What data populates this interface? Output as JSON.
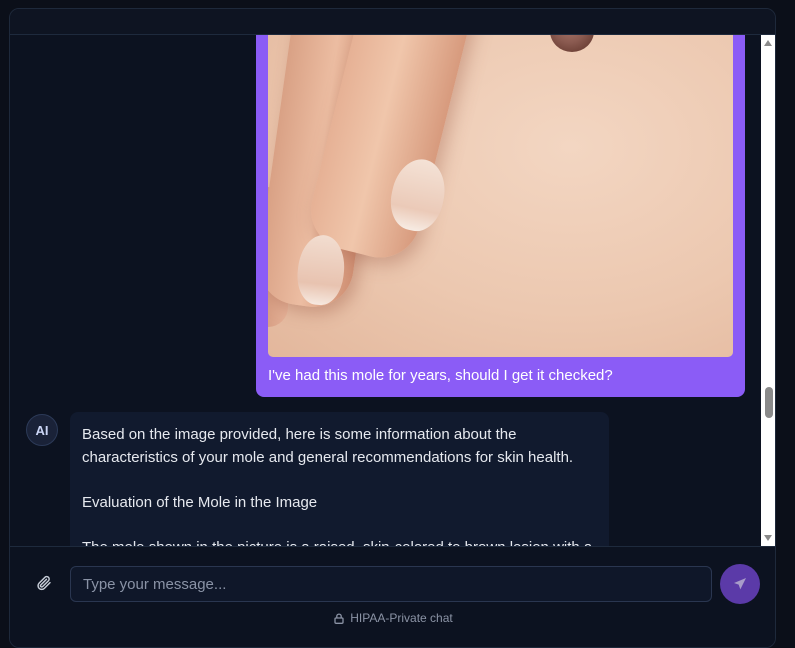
{
  "conversation": {
    "user_message": {
      "text": "I've had this mole for years, should I get it checked?",
      "attachment_icon": "photo-of-mole-on-skin"
    },
    "ai_message": {
      "avatar_label": "AI",
      "paragraphs": [
        "Based on the image provided, here is some information about the characteristics of your mole and general recommendations for skin health.",
        "Evaluation of the Mole in the Image",
        "The mole shown in the picture is a raised, skin-colored to brown lesion with a"
      ]
    }
  },
  "composer": {
    "placeholder": "Type your message...",
    "attach_icon": "paperclip-icon",
    "send_icon": "send-arrow-icon"
  },
  "footer": {
    "privacy_text": "HIPAA-Private chat",
    "privacy_icon": "lock-icon"
  },
  "colors": {
    "background": "#0b0f19",
    "user_bubble": "#8b5cf6",
    "ai_bubble": "#111a2e",
    "send_button": "#5b3aa8"
  },
  "scroll": {
    "position_fraction": 0.72
  }
}
